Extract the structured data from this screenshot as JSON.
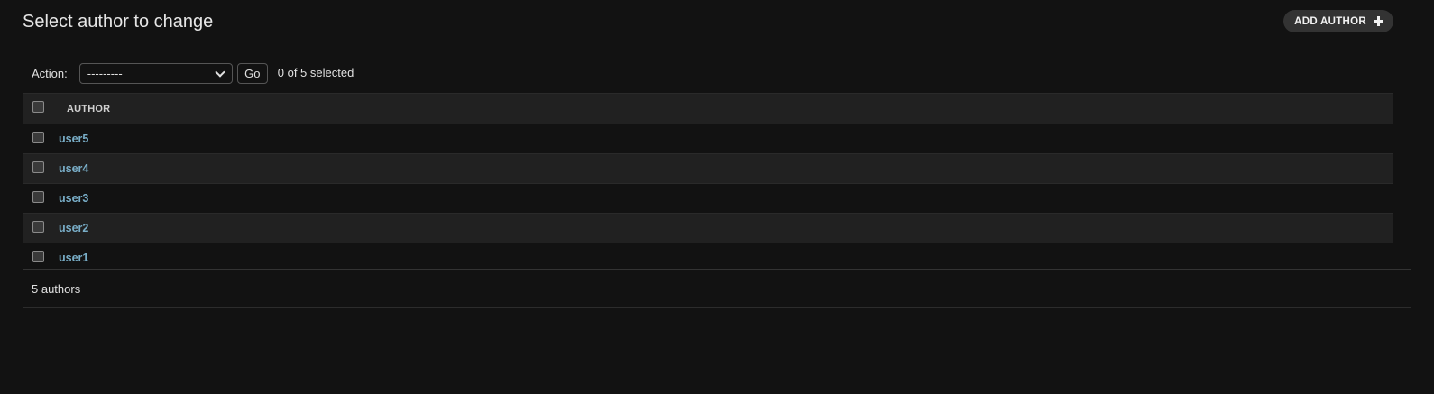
{
  "page": {
    "title": "Select author to change",
    "add_button_label": "ADD AUTHOR"
  },
  "actions": {
    "label": "Action:",
    "selected_option": "---------",
    "go_label": "Go",
    "selection_status": "0 of 5 selected"
  },
  "table": {
    "column_header": "AUTHOR",
    "rows": [
      {
        "label": "user5"
      },
      {
        "label": "user4"
      },
      {
        "label": "user3"
      },
      {
        "label": "user2"
      },
      {
        "label": "user1"
      }
    ]
  },
  "paginator": {
    "count_text": "5 authors"
  },
  "colors": {
    "background": "#121212",
    "row_alt": "#212121",
    "link": "#79aec8",
    "button_bg": "#333333"
  }
}
